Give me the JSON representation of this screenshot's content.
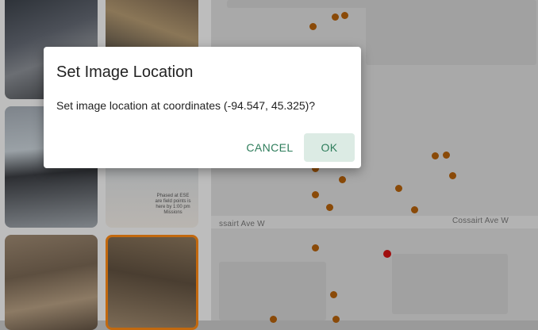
{
  "dialog": {
    "title": "Set Image Location",
    "message": "Set image location at coordinates (-94.547, 45.325)?",
    "cancel_label": "CANCEL",
    "ok_label": "OK"
  },
  "map": {
    "street_labels": [
      "ssairt Ave W",
      "Cossairt Ave W"
    ],
    "marker_color": "#8a4a08",
    "selected_marker_color": "#a00e0e"
  },
  "thumbnails": {
    "sign_text": "Phased at ESE are field points is here by 1:00 pm Missions"
  },
  "colors": {
    "accent": "#2e7d5b",
    "ok_background": "#dcebe4",
    "overlay": "rgba(0,0,0,0.35)"
  }
}
